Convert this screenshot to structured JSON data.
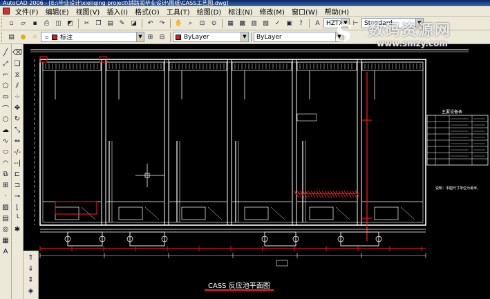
{
  "titlebar": {
    "title": "AutoCAD 2006 - [E:\\毕业设计\\xieliqing project\\铺路润毕业设计\\图纸\\CASS工艺图.dwg]"
  },
  "menu": {
    "items": [
      "文件(F)",
      "编辑(E)",
      "视图(V)",
      "插入(I)",
      "格式(O)",
      "工具(T)",
      "绘图(D)",
      "标注(N)",
      "修改(M)",
      "窗口(W)",
      "帮助(H)"
    ]
  },
  "toolbar": {
    "text_style": "HZTXT",
    "dim_style": "Standard"
  },
  "layers": {
    "current_layer": "标注",
    "color_value": "ByLayer",
    "linetype_value": "ByLayer",
    "layer_color": "#cc2222",
    "color_swatch": "#cc2222"
  },
  "drawing": {
    "caption": "CASS 反应池平面图",
    "table_title": "主要设备表",
    "note_text": "说明：本图尺寸单位为毫米。"
  },
  "watermark": {
    "logo": "S",
    "text": "数码资源网",
    "url": "www.smzy.com"
  },
  "colors": {
    "background": "#000000",
    "line_white": "#ffffff",
    "line_red": "#ff2020",
    "ui_face": "#ece9d8"
  }
}
